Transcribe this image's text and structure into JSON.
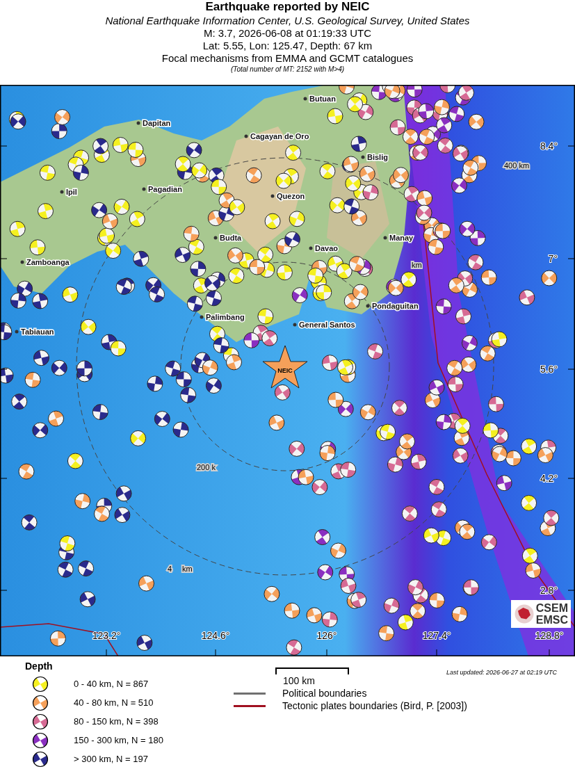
{
  "header": {
    "title": "Earthquake reported by NEIC",
    "subtitle": "National Earthquake Information Center, U.S. Geological Survey, United States",
    "event_line": "M: 3.7,  2026-06-08 at 01:19:33 UTC",
    "location_line": "Lat: 5.55, Lon: 125.47, Depth: 67 km",
    "source_line": "Focal mechanisms from EMMA and GCMT catalogues",
    "total_line": "(Total number of MT: 2152 with M>4)"
  },
  "map": {
    "cities": [
      "Butuan",
      "Dapitan",
      "Cagayan de Oro",
      "Bislig",
      "Ipil",
      "Pagadian",
      "Quezon",
      "Budta",
      "Davao",
      "Manay",
      "Zamboanga",
      "Pondaguitan",
      "Palimbang",
      "General Santos",
      "Tabiauan"
    ],
    "distance_labels": [
      "400 km",
      "km",
      "200 k",
      "4",
      "km"
    ],
    "lat_labels": [
      "8.4°",
      "7°",
      "5.6°",
      "4.2°",
      "2.8°"
    ],
    "lon_labels": [
      "123.2°",
      "124.6°",
      "126°",
      "127.4°",
      "128.8°"
    ],
    "epicenter_label": "NEIC",
    "logo": [
      "CSEM",
      "EMSC"
    ]
  },
  "legend": {
    "title": "Depth",
    "items": [
      {
        "label": "0 - 40 km, N = 867",
        "color": "#f5f020"
      },
      {
        "label": "40 - 80 km, N = 510",
        "color": "#f5a05a"
      },
      {
        "label": "80 - 150 km, N = 398",
        "color": "#d66a94"
      },
      {
        "label": "150 - 300 km, N = 180",
        "color": "#8a2fc0"
      },
      {
        "label": "> 300 km, N = 197",
        "color": "#2a2a8c"
      }
    ],
    "scale_label": "100 km",
    "lines": [
      {
        "label": "Political boundaries",
        "color": "#707070"
      },
      {
        "label": "Tectonic plates boundaries (Bird, P. [2003])",
        "color": "#a01020"
      }
    ],
    "last_updated": "Last updated: 2026-06-27 at 02:19 UTC"
  }
}
